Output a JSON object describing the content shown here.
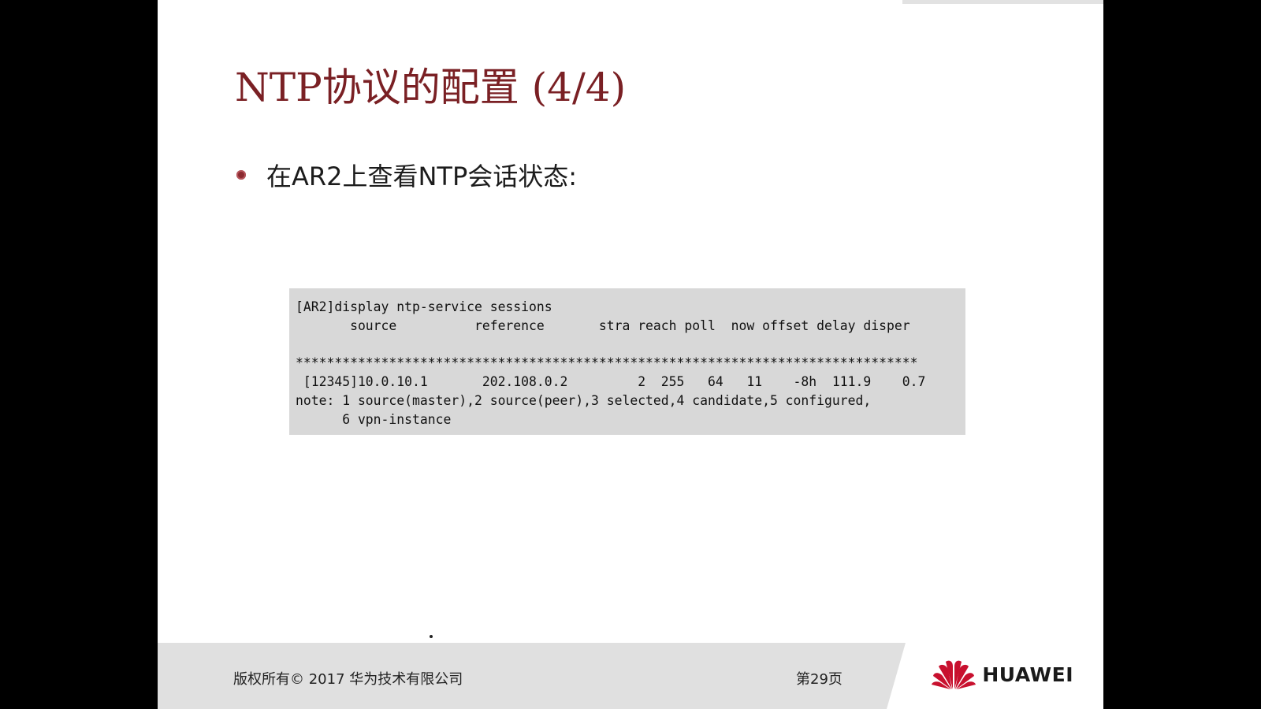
{
  "slide": {
    "title": "NTP协议的配置 (4/4)",
    "bullet": "在AR2上查看NTP会话状态:",
    "code_lines": [
      "[AR2]display ntp-service sessions",
      "       source          reference       stra reach poll  now offset delay disper",
      "",
      "********************************************************************************",
      " [12345]10.0.10.1       202.108.0.2         2  255   64   11    -8h  111.9    0.7",
      "note: 1 source(master),2 source(peer),3 selected,4 candidate,5 configured,",
      "      6 vpn-instance"
    ]
  },
  "footer": {
    "copyright": "版权所有© 2017 华为技术有限公司",
    "page": "第29页",
    "brand": "HUAWEI"
  },
  "colors": {
    "title": "#7a2024",
    "logo_red": "#c8102e",
    "code_bg": "#d8d8d8",
    "footer_bg": "#e0e0e0"
  }
}
